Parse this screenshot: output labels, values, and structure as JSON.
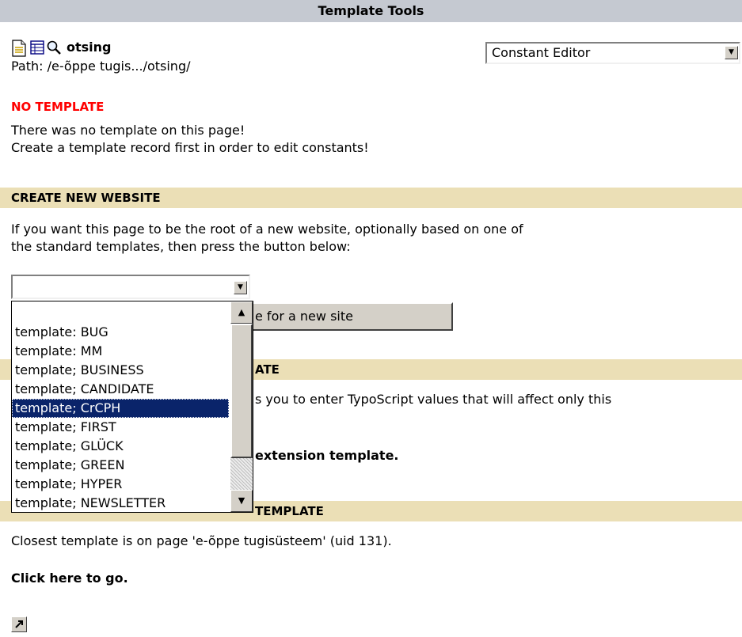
{
  "header": {
    "title": "Template Tools"
  },
  "page": {
    "title": "otsing",
    "path": "Path: /e-õppe tugis.../otsing/"
  },
  "function_menu": {
    "selected": "Constant Editor"
  },
  "no_template": {
    "heading": "NO TEMPLATE",
    "line1": "There was no template on this page!",
    "line2": "Create a template record first in order to edit constants!"
  },
  "create_website": {
    "heading": "CREATE NEW WEBSITE",
    "line1": "If you want this page to be the root of a new website, optionally based on one of",
    "line2": "the standard templates, then press the button below:",
    "select_value": "",
    "button_visible_text": "e for a new site",
    "options": [
      "template: BUG",
      "template: MM",
      "template; BUSINESS",
      "template; CANDIDATE",
      "template; CrCPH",
      "template; FIRST",
      "template; GLÜCK",
      "template; GREEN",
      "template; HYPER",
      "template; NEWSLETTER"
    ]
  },
  "extension": {
    "heading_visible": "ATE",
    "line_visible": "s you to enter TypoScript values that will affect only this",
    "link_visible": "extension template."
  },
  "closest": {
    "heading_visible": "TEMPLATE",
    "line": "Closest template is on page 'e-õppe tugisüsteem' (uid 131).",
    "link": "Click here to go."
  },
  "colors": {
    "title_bar": "#c5c9d1",
    "section_header": "#ebdfb6",
    "error": "#ff0000",
    "selection": "#0a246a"
  }
}
